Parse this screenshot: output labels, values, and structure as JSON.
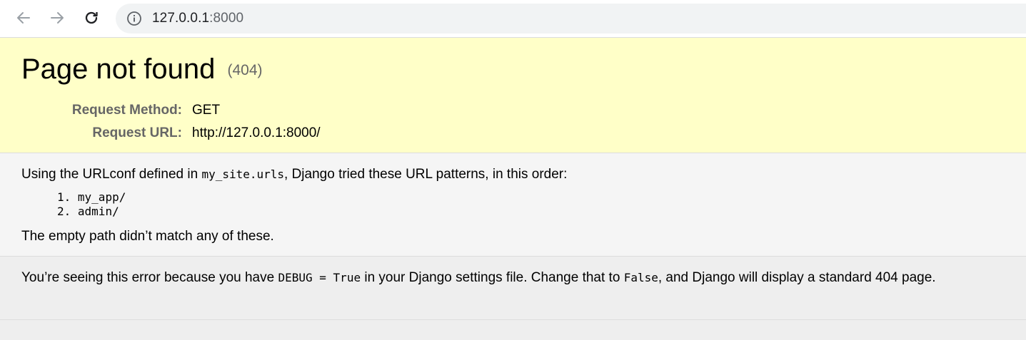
{
  "browser": {
    "url_host": "127.0.0.1",
    "url_port": ":8000"
  },
  "summary": {
    "title": "Page not found",
    "status_code": "(404)",
    "request_method_label": "Request Method:",
    "request_method_value": "GET",
    "request_url_label": "Request URL:",
    "request_url_value": "http://127.0.0.1:8000/"
  },
  "info": {
    "line1_prefix": "Using the URLconf defined in ",
    "urlconf": "my_site.urls",
    "line1_suffix": ", Django tried these URL patterns, in this order:",
    "patterns": [
      "my_app/",
      "admin/"
    ],
    "pattern_numbers": [
      "1.",
      "2."
    ],
    "no_match": "The empty path didn’t match any of these."
  },
  "explanation": {
    "part1": "You’re seeing this error because you have ",
    "debug_code": "DEBUG = True",
    "part2": " in your Django settings file. Change that to ",
    "false_code": "False",
    "part3": ", and Django will display a standard 404 page."
  },
  "colors": {
    "summary_bg": "#ffffc8",
    "info_bg": "#f5f5f5",
    "explanation_bg": "#eeeeee"
  }
}
